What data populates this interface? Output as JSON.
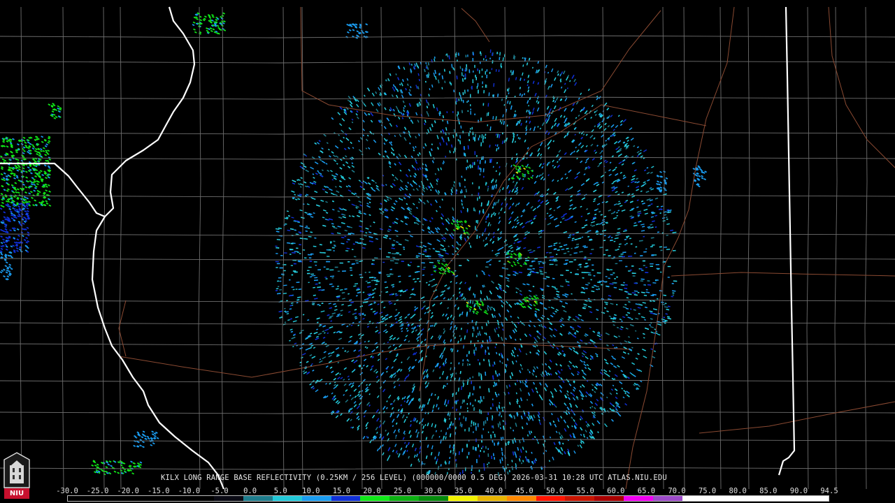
{
  "product": {
    "caption": "KILX LONG RANGE BASE REFLECTIVITY (0.25KM / 256 LEVEL) (000000/0000 0.5 DEG) 2026-03-31 10:28 UTC  ATLAS.NIU.EDU",
    "logo_text": "NIU"
  },
  "color_scale": {
    "labels": [
      "-30.0",
      "-25.0",
      "-20.0",
      "-15.0",
      "-10.0",
      "-5.0",
      "0.0",
      "5.0",
      "10.0",
      "15.0",
      "20.0",
      "25.0",
      "30.0",
      "35.0",
      "40.0",
      "45.0",
      "50.0",
      "55.0",
      "60.0",
      "65.0",
      "70.0",
      "75.0",
      "80.0",
      "85.0",
      "90.0",
      "94.5"
    ],
    "colors": [
      "#000000",
      "#000000",
      "#000000",
      "#000000",
      "#000000",
      "#0a0a14",
      "#1e7c8c",
      "#22c8d8",
      "#1a9cf0",
      "#1030d8",
      "#10e818",
      "#0cb012",
      "#058a0c",
      "#f2f200",
      "#e8b400",
      "#ff8800",
      "#ff1400",
      "#c81400",
      "#a80000",
      "#f000f0",
      "#9c4ac8",
      "#ffffff",
      "#ffffff",
      "#ffffff",
      "#ffffff",
      "#ffffff"
    ]
  }
}
